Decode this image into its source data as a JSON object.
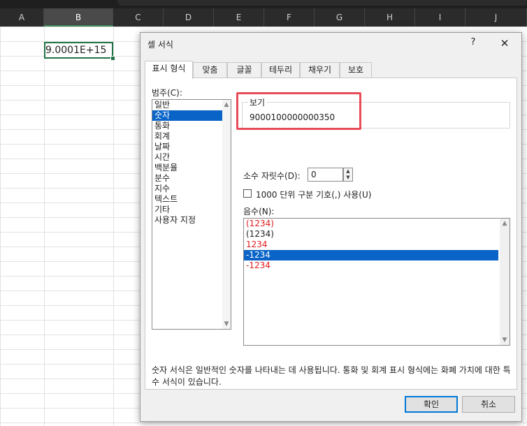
{
  "spreadsheet": {
    "columns": [
      "A",
      "B",
      "C",
      "D",
      "E",
      "F",
      "G",
      "H",
      "I",
      "J"
    ],
    "selected_column": "B",
    "active_cell_value": "9.0001E+15"
  },
  "dialog": {
    "title": "셀 서식",
    "help_label": "?",
    "close_label": "✕",
    "tabs": [
      {
        "label": "표시 형식",
        "active": true
      },
      {
        "label": "맞춤",
        "active": false
      },
      {
        "label": "글꼴",
        "active": false
      },
      {
        "label": "테두리",
        "active": false
      },
      {
        "label": "채우기",
        "active": false
      },
      {
        "label": "보호",
        "active": false
      }
    ],
    "category_label": "범주(C):",
    "categories": [
      "일반",
      "숫자",
      "통화",
      "회계",
      "날짜",
      "시간",
      "백분율",
      "분수",
      "지수",
      "텍스트",
      "기타",
      "사용자 지정"
    ],
    "selected_category": "숫자",
    "sample_label": "보기",
    "sample_value": "9000100000000350",
    "decimal_places_label": "소수 자릿수(D):",
    "decimal_places_value": "0",
    "thousands_separator_label": "1000 단위 구분 기호(,) 사용(U)",
    "thousands_separator_checked": false,
    "negative_numbers_label": "음수(N):",
    "negative_numbers": [
      {
        "text": "(1234)",
        "color": "red"
      },
      {
        "text": "(1234)",
        "color": "black"
      },
      {
        "text": "1234",
        "color": "red"
      },
      {
        "text": "-1234",
        "color": "black",
        "selected": true
      },
      {
        "text": "-1234",
        "color": "red"
      }
    ],
    "description": "숫자 서식은 일반적인 숫자를 나타내는 데 사용됩니다. 통화 및 회계 표시 형식에는 화폐 가치에 대한 특수 서식이 있습니다.",
    "ok_label": "확인",
    "cancel_label": "취소"
  },
  "colors": {
    "accent": "#0a64c8",
    "negative_red": "#e01b1b",
    "highlight_border": "#e84c59",
    "cell_border": "#217346"
  }
}
